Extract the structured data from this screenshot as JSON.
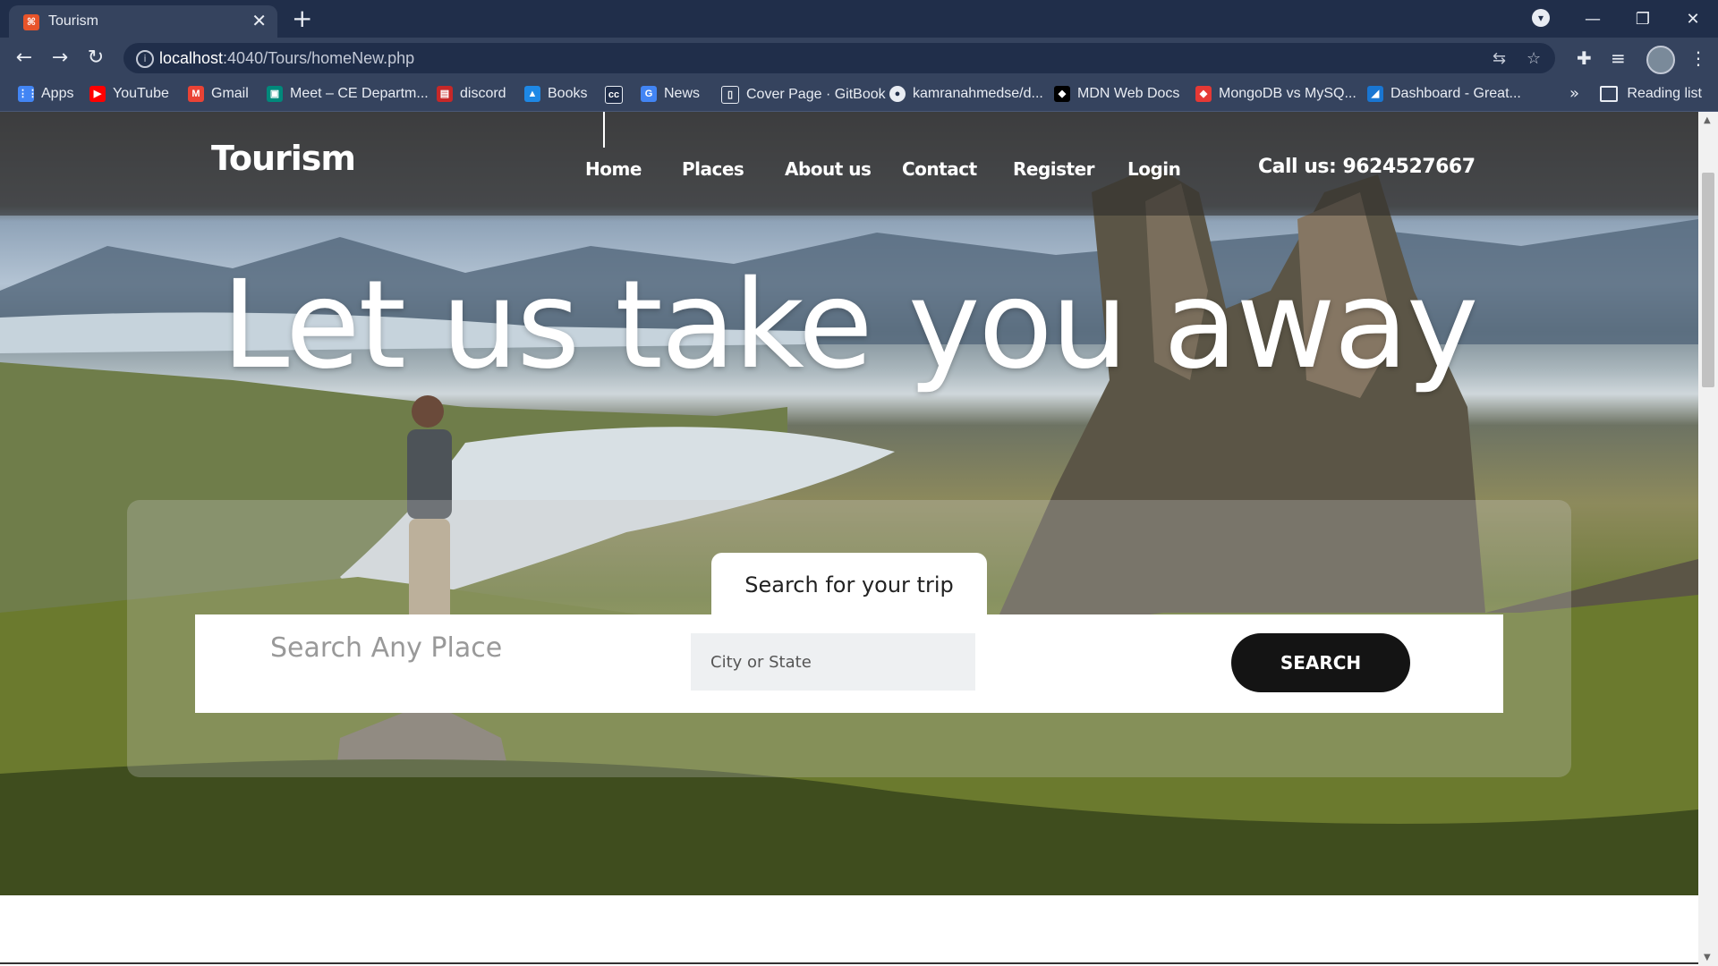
{
  "browser": {
    "tab_title": "Tourism",
    "tab_favicon_text": "",
    "url_host": "localhost",
    "url_path": ":4040/Tours/homeNew.php",
    "reading_list_label": "Reading list",
    "bookmarks": [
      {
        "label": "Apps",
        "color": "#4285f4"
      },
      {
        "label": "YouTube",
        "color": "#ff0000"
      },
      {
        "label": "Gmail",
        "color": "#ea4335"
      },
      {
        "label": "Meet – CE Departm...",
        "color": "#00897b"
      },
      {
        "label": "discord",
        "color": "#c62828"
      },
      {
        "label": "Books",
        "color": "#1e88e5"
      },
      {
        "label": "",
        "color": "#202e4a"
      },
      {
        "label": "News",
        "color": "#4285f4"
      },
      {
        "label": "Cover Page · GitBook",
        "color": "#e8ecf3"
      },
      {
        "label": "kamranahmedse/d...",
        "color": "#e8ecf3"
      },
      {
        "label": "MDN Web Docs",
        "color": "#000000"
      },
      {
        "label": "MongoDB vs MySQ...",
        "color": "#e53935"
      },
      {
        "label": "Dashboard - Great...",
        "color": "#1976d2"
      }
    ]
  },
  "site": {
    "brand": "Tourism",
    "nav": [
      "Home",
      "Places",
      "About us",
      "Contact",
      "Register",
      "Login"
    ],
    "call": "Call us: 9624527667",
    "headline": "Let us take you away",
    "search_tab": "Search for your trip",
    "search_heading": "Search Any Place",
    "city_placeholder": "City or State",
    "search_button": "SEARCH"
  },
  "colors": {
    "chrome_dark": "#202e4a",
    "chrome_mid": "#35435e",
    "search_button": "#141414"
  }
}
